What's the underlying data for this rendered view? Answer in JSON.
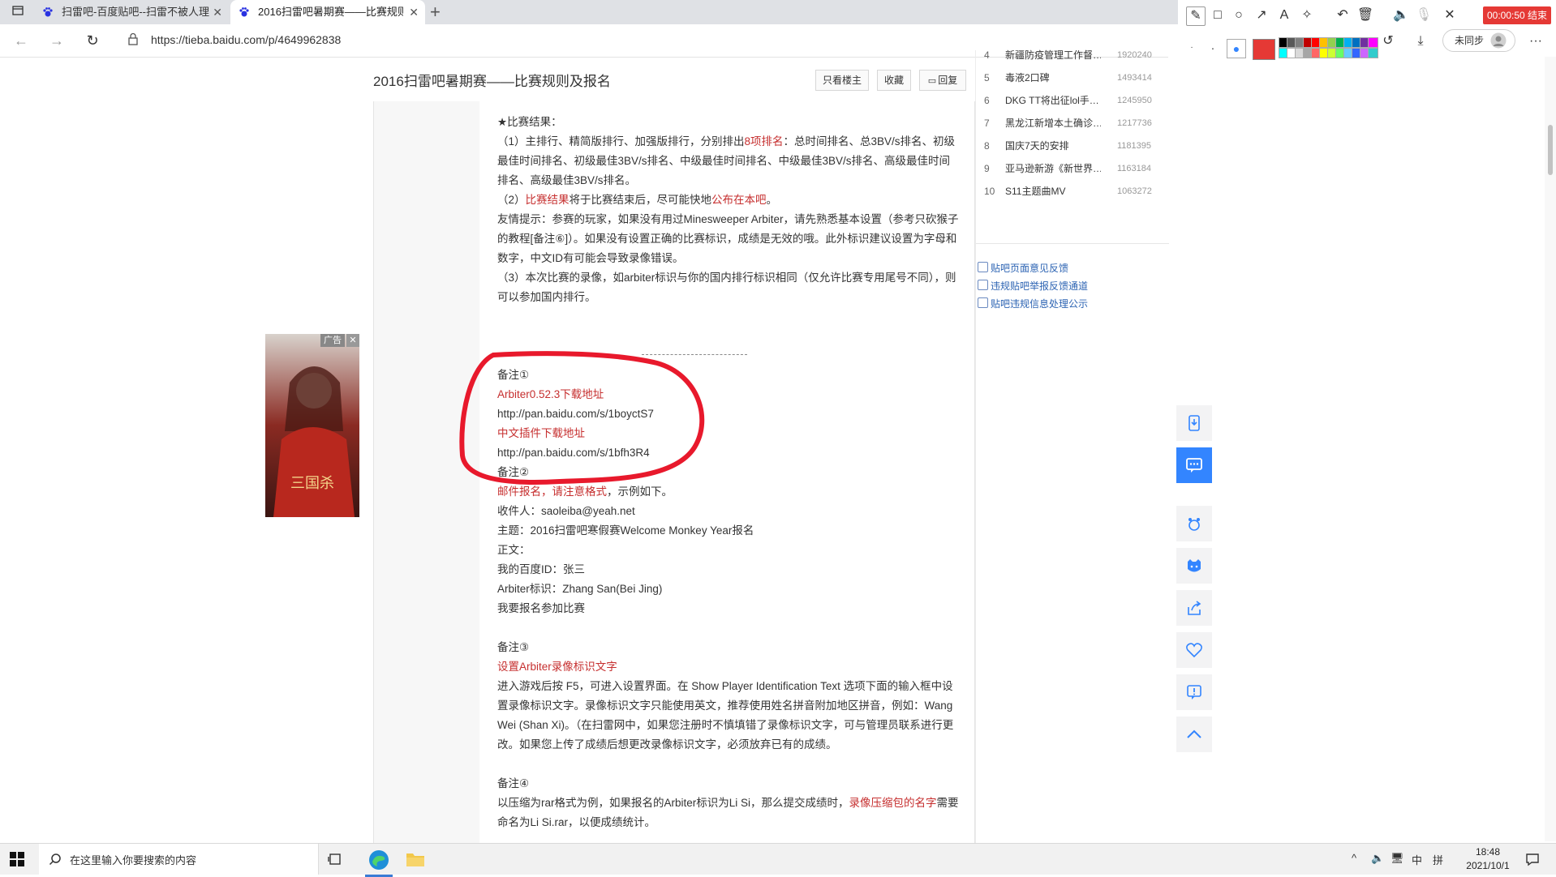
{
  "browser": {
    "tabs": [
      {
        "title": "扫雷吧-百度贴吧--扫雷不被人理",
        "active": false
      },
      {
        "title": "2016扫雷吧暑期赛——比赛规则",
        "active": true
      }
    ],
    "url": "https://tieba.baidu.com/p/4649962838"
  },
  "drawing_toolbar": {
    "timer": "00:00:50 结束",
    "sync_label": "未同步",
    "accent": "#e53935",
    "palette": [
      "#000000",
      "#595959",
      "#7f7f7f",
      "#c00000",
      "#ff0000",
      "#ffc000",
      "#92d050",
      "#00b050",
      "#00b0f0",
      "#0070c0",
      "#7030a0",
      "#ff00ff",
      "#00ffff",
      "#ffffff",
      "#d9d9d9",
      "#a6a6a6",
      "#ff6666",
      "#ffff00",
      "#ccff33",
      "#66ff66",
      "#66ccff",
      "#3366ff",
      "#cc66ff",
      "#33cccc"
    ]
  },
  "post": {
    "title": "2016扫雷吧暑期赛——比赛规则及报名",
    "buttons": {
      "only_op": "只看楼主",
      "favorite": "收藏",
      "reply": "回复"
    },
    "results_heading": "★比赛结果：",
    "results_1_a": "（1）主排行、精简版排行、加强版排行，分别排出",
    "results_1_red": "8项排名",
    "results_1_b": "：总时间排名、总3BV/s排名、初级最佳时间排名、初级最佳3BV/s排名、中级最佳时间排名、中级最佳3BV/s排名、高级最佳时间排名、高级最佳3BV/s排名。",
    "results_2_a": "（2）",
    "results_2_red": "比赛结果",
    "results_2_b": "将于比赛结束后，尽可能快地",
    "results_2_red2": "公布在本吧",
    "results_2_c": "。",
    "tip": "友情提示：参赛的玩家，如果没有用过Minesweeper Arbiter，请先熟悉基本设置（参考只砍猴子的教程[备注⑥]）。如果没有设置正确的比赛标识，成绩是无效的哦。此外标识建议设置为字母和数字，中文ID有可能会导致录像错误。",
    "results_3": "（3）本次比赛的录像，如arbiter标识与你的国内排行标识相同（仅允许比赛专用尾号不同），则可以参加国内排行。",
    "note1_title": "备注①",
    "note1_link1_label": "Arbiter0.52.3下载地址",
    "note1_link1_url": "http://pan.baidu.com/s/1boyctS7",
    "note1_link2_label": "中文插件下载地址",
    "note1_link2_url": "http://pan.baidu.com/s/1bfh3R4",
    "note2_title": "备注②",
    "note2_red": "邮件报名，请注意格式",
    "note2_tail": "，示例如下。",
    "note2_to": "收件人：saoleiba@yeah.net",
    "note2_subject": "主题：2016扫雷吧寒假赛Welcome Monkey Year报名",
    "note2_body": "正文：",
    "note2_id": "我的百度ID：张三",
    "note2_arbiter": "Arbiter标识：Zhang San(Bei Jing)",
    "note2_join": "我要报名参加比赛",
    "note3_title": "备注③",
    "note3_red": "设置Arbiter录像标识文字",
    "note3_body": "进入游戏后按 F5，可进入设置界面。在 Show Player Identification Text 选项下面的输入框中设置录像标识文字。录像标识文字只能使用英文，推荐使用姓名拼音附加地区拼音，例如：Wang Wei (Shan Xi)。（在扫雷网中，如果您注册时不慎填错了录像标识文字，可与管理员联系进行更改。如果您上传了成绩后想更改录像标识文字，必须放弃已有的成绩。",
    "note4_title": "备注④",
    "note4_a": "以压缩为rar格式为例，如果报名的Arbiter标识为Li Si，那么提交成绩时，",
    "note4_red": "录像压缩包的名字",
    "note4_b": "需要命名为Li Si.rar，以便成绩统计。"
  },
  "ad": {
    "label": "广告",
    "close": "✕"
  },
  "sidebar": {
    "hot_list": [
      {
        "rank": "4",
        "title": "新疆防疫管理工作督…",
        "count": "1920240"
      },
      {
        "rank": "5",
        "title": "毒液2口碑",
        "count": "1493414"
      },
      {
        "rank": "6",
        "title": "DKG TT将出征lol手…",
        "count": "1245950"
      },
      {
        "rank": "7",
        "title": "黑龙江新增本土确诊…",
        "count": "1217736"
      },
      {
        "rank": "8",
        "title": "国庆7天的安排",
        "count": "1181395"
      },
      {
        "rank": "9",
        "title": "亚马逊新游《新世界…",
        "count": "1163184"
      },
      {
        "rank": "10",
        "title": "S11主题曲MV",
        "count": "1063272"
      }
    ],
    "links": [
      "贴吧页面意见反馈",
      "违规贴吧举报反馈通道",
      "贴吧违规信息处理公示"
    ]
  },
  "taskbar": {
    "search_placeholder": "在这里输入你要搜索的内容",
    "time": "18:48",
    "date": "2021/10/1",
    "ime": "中",
    "ime2": "拼"
  }
}
